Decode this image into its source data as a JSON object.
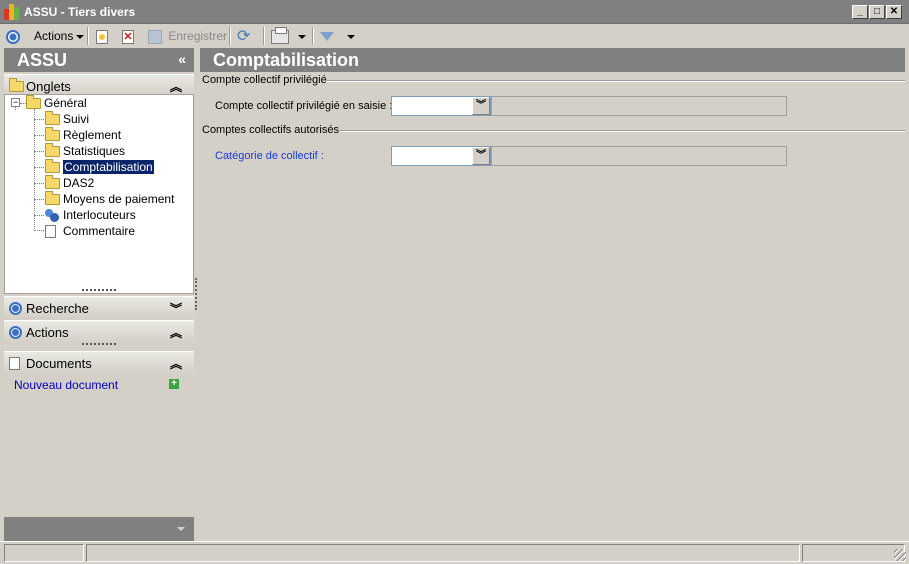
{
  "window": {
    "title": "ASSU -  Tiers divers",
    "minimize_glyph": "_",
    "maximize_glyph": "□",
    "close_glyph": "✕"
  },
  "toolbar": {
    "actions_label": "Actions",
    "save_label": "Enregistrer"
  },
  "left_panel": {
    "header": "ASSU",
    "collapse_glyph": "«",
    "sections": {
      "onglets": "Onglets",
      "recherche": "Recherche",
      "actions": "Actions",
      "documents": "Documents"
    },
    "tree": {
      "root": "Général",
      "items": [
        "Suivi",
        "Règlement",
        "Statistiques",
        "Comptabilisation",
        "DAS2",
        "Moyens de paiement",
        "Interlocuteurs",
        "Commentaire"
      ],
      "selected": "Comptabilisation"
    },
    "new_document_link": "Nouveau document"
  },
  "main": {
    "title": "Comptabilisation",
    "group1": {
      "title": "Compte collectif privilégié",
      "field_label": "Compte collectif privilégié en saisie :",
      "value": ""
    },
    "group2": {
      "title": "Comptes collectifs autorisés",
      "field_label": "Catégorie de collectif :",
      "value": ""
    }
  },
  "colors": {
    "header_gray": "#808080",
    "background": "#d4d0c8",
    "selection": "#0a246a",
    "link_blue": "#0000c0"
  }
}
